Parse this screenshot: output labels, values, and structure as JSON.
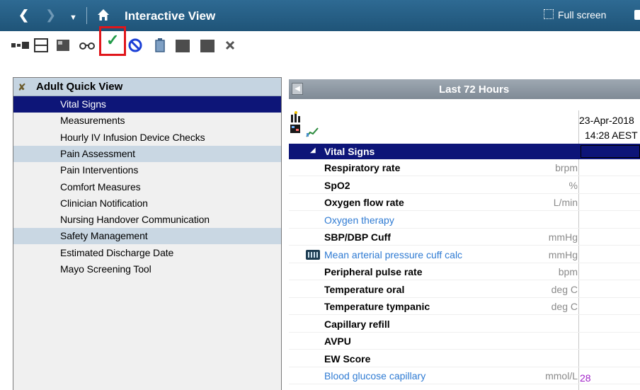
{
  "titlebar": {
    "back_icon": "chevron-left",
    "forward_icon": "chevron-right",
    "dropdown_icon": "caret-down",
    "home_icon": "home",
    "title": "Interactive View",
    "fullscreen_label": "Full screen"
  },
  "toolbar": {
    "icons": [
      "insert-icon",
      "layout-icon",
      "panel-icon",
      "glasses-icon",
      "sign-checkmark-icon",
      "no-entry-icon",
      "trash-icon",
      "folder-icon",
      "folder-dark-icon",
      "close-x-icon"
    ],
    "highlight_color": "#e0161b"
  },
  "navigator": {
    "title": "Adult Quick View",
    "items": [
      {
        "label": "Vital Signs",
        "state": "selected"
      },
      {
        "label": "Measurements",
        "state": "plain"
      },
      {
        "label": "Hourly IV Infusion Device Checks",
        "state": "plain"
      },
      {
        "label": "Pain Assessment",
        "state": "shade"
      },
      {
        "label": "Pain Interventions",
        "state": "plain"
      },
      {
        "label": "Comfort Measures",
        "state": "plain"
      },
      {
        "label": "Clinician Notification",
        "state": "plain"
      },
      {
        "label": "Nursing Handover Communication",
        "state": "plain"
      },
      {
        "label": "Safety Management",
        "state": "shade"
      },
      {
        "label": "Estimated Discharge Date",
        "state": "plain"
      },
      {
        "label": "Mayo Screening Tool",
        "state": "plain"
      }
    ]
  },
  "flowsheet": {
    "range_label": "Last 72 Hours",
    "column_date": "23-Apr-2018",
    "column_time": "14:28 AEST",
    "section_label": "Vital Signs",
    "rows": [
      {
        "label": "Respiratory rate",
        "unit": "brpm",
        "style": "bold",
        "value": ""
      },
      {
        "label": "SpO2",
        "unit": "%",
        "style": "bold",
        "value": ""
      },
      {
        "label": "Oxygen flow rate",
        "unit": "L/min",
        "style": "bold",
        "value": ""
      },
      {
        "label": "Oxygen therapy",
        "unit": "",
        "style": "link",
        "value": ""
      },
      {
        "label": "SBP/DBP Cuff",
        "unit": "mmHg",
        "style": "bold",
        "value": ""
      },
      {
        "label": "Mean arterial pressure cuff calc",
        "unit": "mmHg",
        "style": "link",
        "value": "",
        "icon": "calculator-icon"
      },
      {
        "label": "Peripheral pulse rate",
        "unit": "bpm",
        "style": "bold",
        "value": ""
      },
      {
        "label": "Temperature oral",
        "unit": "deg C",
        "style": "bold",
        "value": ""
      },
      {
        "label": "Temperature tympanic",
        "unit": "deg C",
        "style": "bold",
        "value": ""
      },
      {
        "label": "Capillary refill",
        "unit": "",
        "style": "bold",
        "value": ""
      },
      {
        "label": "AVPU",
        "unit": "",
        "style": "bold",
        "value": ""
      },
      {
        "label": "EW Score",
        "unit": "",
        "style": "bold",
        "value": ""
      },
      {
        "label": "Blood glucose capillary",
        "unit": "mmol/L",
        "style": "link",
        "value": "28"
      }
    ]
  }
}
